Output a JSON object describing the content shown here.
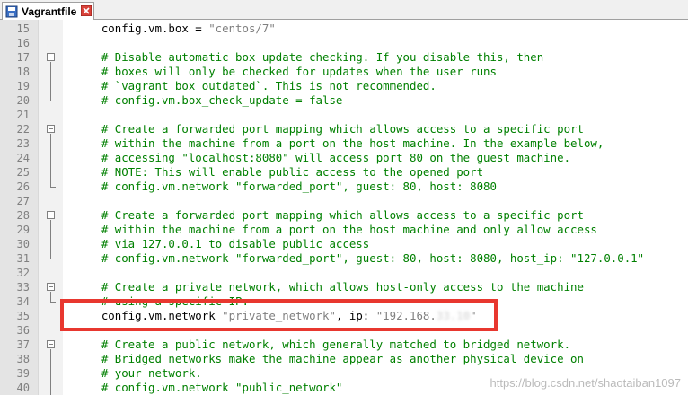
{
  "tab": {
    "title": "Vagrantfile"
  },
  "lines": [
    {
      "num": "15",
      "code": "    config.vm.box = ",
      "str": "\"centos/7\""
    },
    {
      "num": "16"
    },
    {
      "num": "17",
      "comment": "    # Disable automatic box update checking. If you disable this, then"
    },
    {
      "num": "18",
      "comment": "    # boxes will only be checked for updates when the user runs"
    },
    {
      "num": "19",
      "comment": "    # `vagrant box outdated`. This is not recommended."
    },
    {
      "num": "20",
      "comment": "    # config.vm.box_check_update = false"
    },
    {
      "num": "21"
    },
    {
      "num": "22",
      "comment": "    # Create a forwarded port mapping which allows access to a specific port"
    },
    {
      "num": "23",
      "comment": "    # within the machine from a port on the host machine. In the example below,"
    },
    {
      "num": "24",
      "comment": "    # accessing \"localhost:8080\" will access port 80 on the guest machine."
    },
    {
      "num": "25",
      "comment": "    # NOTE: This will enable public access to the opened port"
    },
    {
      "num": "26",
      "comment": "    # config.vm.network \"forwarded_port\", guest: 80, host: 8080"
    },
    {
      "num": "27"
    },
    {
      "num": "28",
      "comment": "    # Create a forwarded port mapping which allows access to a specific port"
    },
    {
      "num": "29",
      "comment": "    # within the machine from a port on the host machine and only allow access"
    },
    {
      "num": "30",
      "comment": "    # via 127.0.0.1 to disable public access"
    },
    {
      "num": "31",
      "comment": "    # config.vm.network \"forwarded_port\", guest: 80, host: 8080, host_ip: \"127.0.0.1\""
    },
    {
      "num": "32"
    },
    {
      "num": "33",
      "comment": "    # Create a private network, which allows host-only access to the machine"
    },
    {
      "num": "34",
      "comment": "    # using a specific IP."
    },
    {
      "num": "35",
      "code": "    config.vm.network ",
      "str": "\"private_network\"",
      "code2": ", ip: ",
      "str2": "\"192.168.",
      "hidden": "33.10",
      "str3": "\""
    },
    {
      "num": "36"
    },
    {
      "num": "37",
      "comment": "    # Create a public network, which generally matched to bridged network."
    },
    {
      "num": "38",
      "comment": "    # Bridged networks make the machine appear as another physical device on"
    },
    {
      "num": "39",
      "comment": "    # your network."
    },
    {
      "num": "40",
      "comment": "    # config.vm.network \"public_network\""
    }
  ],
  "watermark": "https://blog.csdn.net/shaotaiban1097",
  "colors": {
    "comment": "#008000",
    "string": "#808080",
    "highlight_box": "#e8372f"
  }
}
